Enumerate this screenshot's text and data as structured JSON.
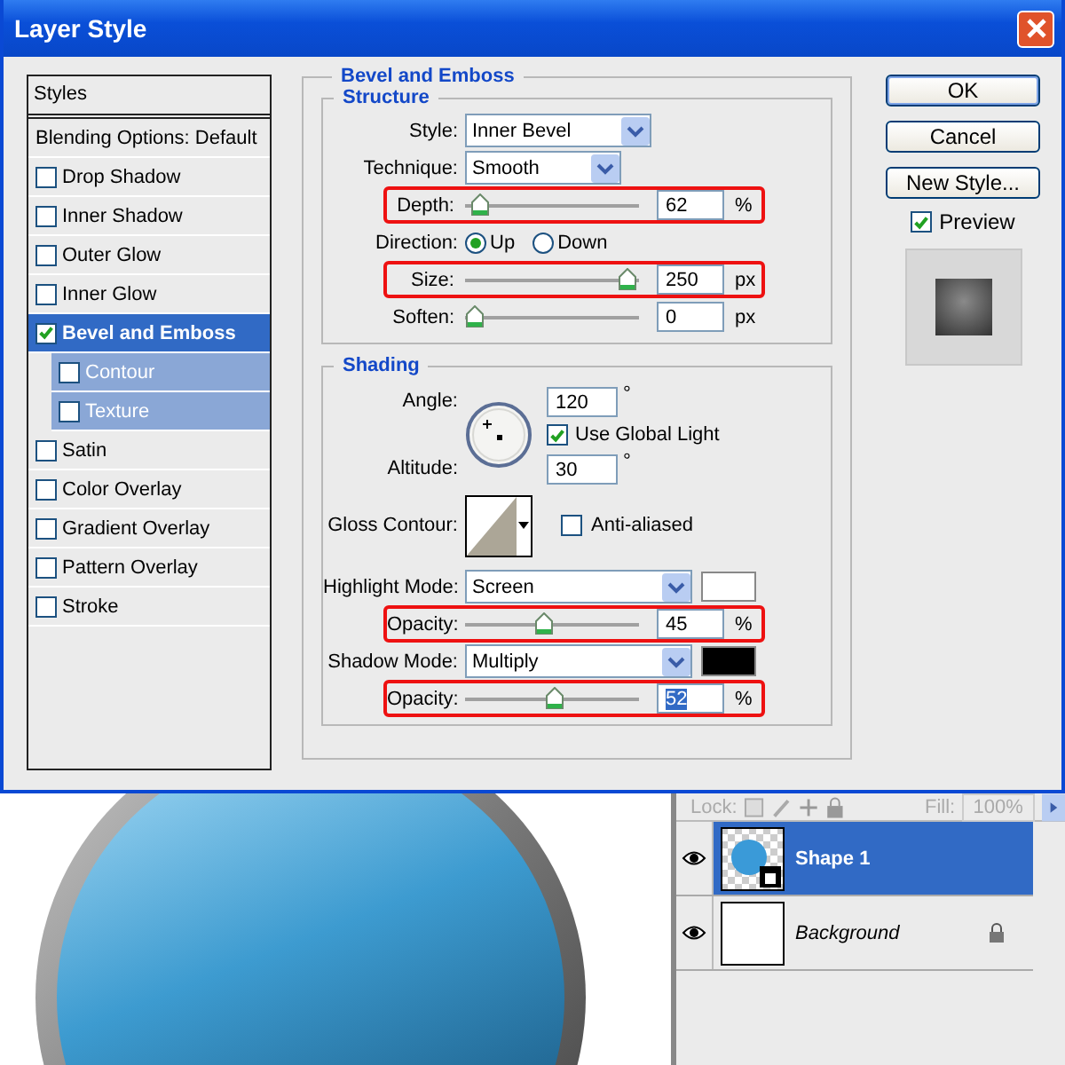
{
  "window": {
    "title": "Layer Style"
  },
  "styles_panel": {
    "header": "Styles",
    "items": [
      {
        "label": "Blending Options: Default",
        "kind": "plain",
        "selected": false
      },
      {
        "label": "Drop Shadow",
        "kind": "check",
        "checked": false,
        "selected": false
      },
      {
        "label": "Inner Shadow",
        "kind": "check",
        "checked": false,
        "selected": false
      },
      {
        "label": "Outer Glow",
        "kind": "check",
        "checked": false,
        "selected": false
      },
      {
        "label": "Inner Glow",
        "kind": "check",
        "checked": false,
        "selected": false
      },
      {
        "label": "Bevel and Emboss",
        "kind": "check",
        "checked": true,
        "selected": true,
        "children": [
          {
            "label": "Contour",
            "kind": "check",
            "checked": false,
            "selected": false
          },
          {
            "label": "Texture",
            "kind": "check",
            "checked": false,
            "selected": false
          }
        ]
      },
      {
        "label": "Satin",
        "kind": "check",
        "checked": false,
        "selected": false
      },
      {
        "label": "Color Overlay",
        "kind": "check",
        "checked": false,
        "selected": false
      },
      {
        "label": "Gradient Overlay",
        "kind": "check",
        "checked": false,
        "selected": false
      },
      {
        "label": "Pattern Overlay",
        "kind": "check",
        "checked": false,
        "selected": false
      },
      {
        "label": "Stroke",
        "kind": "check",
        "checked": false,
        "selected": false
      }
    ]
  },
  "bevel_emboss": {
    "title": "Bevel and Emboss",
    "structure": {
      "title": "Structure",
      "style": {
        "label": "Style:",
        "value": "Inner Bevel"
      },
      "technique": {
        "label": "Technique:",
        "value": "Smooth"
      },
      "depth": {
        "label": "Depth:",
        "level": 0.03,
        "value": "62",
        "unit": "%",
        "highlighted": true
      },
      "direction": {
        "label": "Direction:",
        "options": [
          {
            "label": "Up",
            "selected": true
          },
          {
            "label": "Down",
            "selected": false
          }
        ]
      },
      "size": {
        "label": "Size:",
        "level": 0.99,
        "value": "250",
        "unit": "px",
        "highlighted": true
      },
      "soften": {
        "label": "Soften:",
        "level": 0,
        "value": "0",
        "unit": "px",
        "highlighted": false
      }
    },
    "shading": {
      "title": "Shading",
      "angle": {
        "label": "Angle:",
        "value": "120",
        "unit": "°"
      },
      "use_global_light": {
        "label": "Use Global Light",
        "checked": true
      },
      "altitude": {
        "label": "Altitude:",
        "value": "30",
        "unit": "°"
      },
      "gloss_contour": {
        "label": "Gloss Contour:"
      },
      "anti_aliased": {
        "label": "Anti-aliased",
        "checked": false
      },
      "highlight_mode": {
        "label": "Highlight Mode:",
        "value": "Screen",
        "color": "#ffffff"
      },
      "highlight_opacity": {
        "label": "Opacity:",
        "level": 0.45,
        "value": "45",
        "unit": "%",
        "highlighted": true,
        "text_selected": false
      },
      "shadow_mode": {
        "label": "Shadow Mode:",
        "value": "Multiply",
        "color": "#000000"
      },
      "shadow_opacity": {
        "label": "Opacity:",
        "level": 0.52,
        "value": "52",
        "unit": "%",
        "highlighted": true,
        "text_selected": true
      }
    }
  },
  "buttons": [
    {
      "label": "OK",
      "default": true
    },
    {
      "label": "Cancel",
      "default": false
    },
    {
      "label": "New Style...",
      "default": false
    }
  ],
  "preview": {
    "label": "Preview",
    "checked": true
  },
  "layers_panel": {
    "lock_label": "Lock:",
    "fill_label": "Fill:",
    "fill_value": "100%",
    "layers": [
      {
        "name": "Shape 1",
        "kind": "shape",
        "selected": true,
        "visible": true,
        "locked": false
      },
      {
        "name": "Background",
        "kind": "background",
        "selected": false,
        "visible": true,
        "locked": true
      }
    ]
  }
}
